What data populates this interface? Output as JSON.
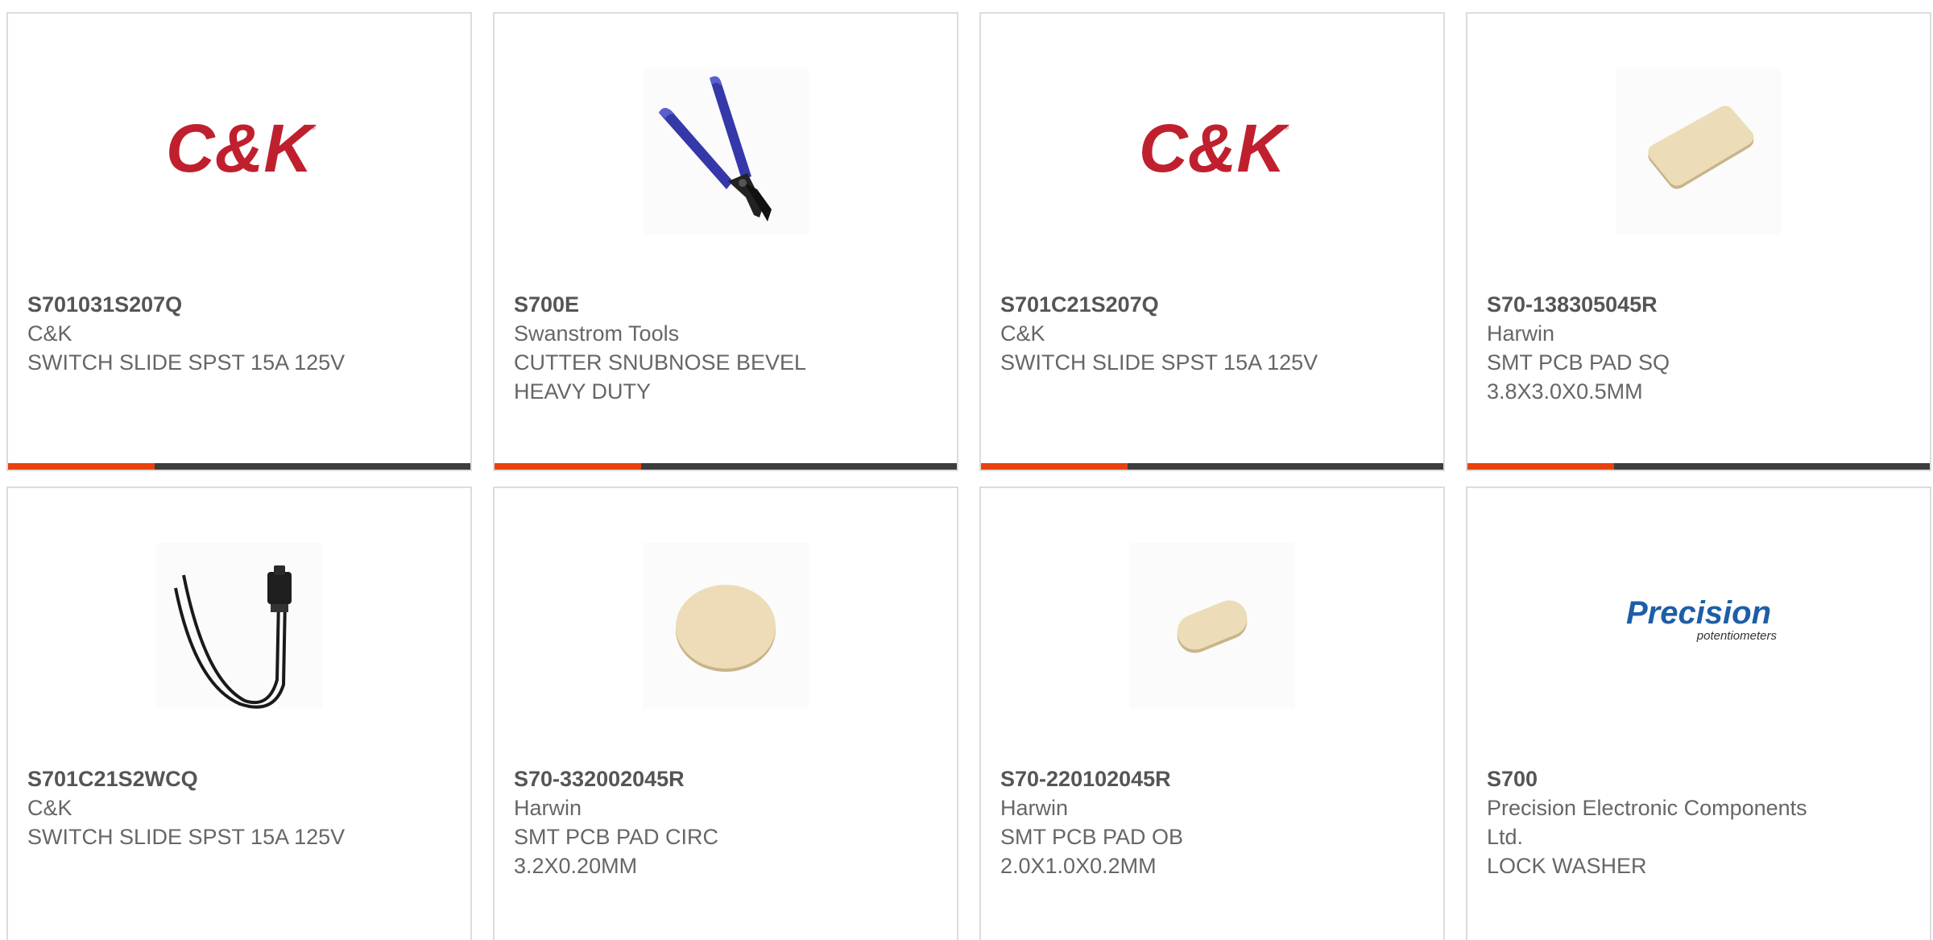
{
  "products": [
    {
      "part_number": "S701031S207Q",
      "manufacturer": "C&K",
      "description": "SWITCH SLIDE SPST 15A 125V",
      "image": "ck-logo",
      "logo_text": "C&K"
    },
    {
      "part_number": "S700E",
      "manufacturer": "Swanstrom Tools",
      "description": "CUTTER SNUBNOSE BEVEL HEAVY DUTY",
      "image": "snubnose-cutter-photo"
    },
    {
      "part_number": "S701C21S207Q",
      "manufacturer": "C&K",
      "description": "SWITCH SLIDE SPST 15A 125V",
      "image": "ck-logo",
      "logo_text": "C&K"
    },
    {
      "part_number": "S70-138305045R",
      "manufacturer": "Harwin",
      "description": "SMT PCB PAD SQ 3.8X3.0X0.5MM",
      "image": "square-gold-pad-photo"
    },
    {
      "part_number": "S701C21S2WCQ",
      "manufacturer": "C&K",
      "description": "SWITCH SLIDE SPST 15A 125V",
      "image": "slide-switch-wired-photo"
    },
    {
      "part_number": "S70-332002045R",
      "manufacturer": "Harwin",
      "description": "SMT PCB PAD CIRC 3.2X0.20MM",
      "image": "round-gold-pad-photo"
    },
    {
      "part_number": "S70-220102045R",
      "manufacturer": "Harwin",
      "description": "SMT PCB PAD OB 2.0X1.0X0.2MM",
      "image": "oblong-gold-pad-photo"
    },
    {
      "part_number": "S700",
      "manufacturer": "Precision Electronic Components Ltd.",
      "description": "LOCK WASHER",
      "image": "precision-potentiometers-logo",
      "logo_text": "Precision",
      "logo_subtext": "potentiometers"
    }
  ],
  "colors": {
    "accent_bar": "#e8430f",
    "dark_bar": "#3d3d3d",
    "card_border": "#dcdcdc",
    "ck_logo_red": "#c0202e",
    "precision_logo_blue": "#1d5ea8"
  }
}
